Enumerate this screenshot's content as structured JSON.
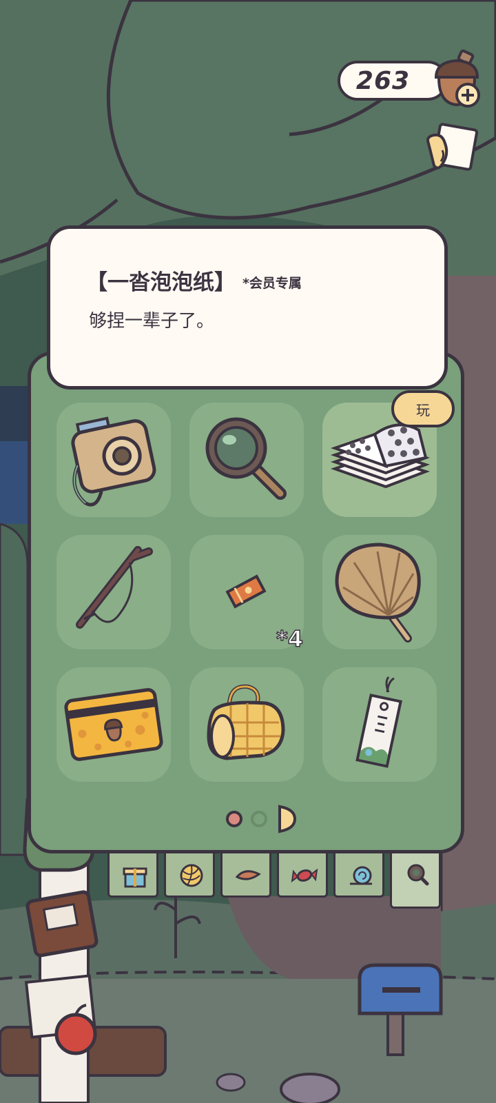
{
  "currency": {
    "amount": "263",
    "icon": "acorn-icon"
  },
  "info_card": {
    "title": "【一沓泡泡纸】",
    "tag": "*会员专属",
    "description": "够捏一辈子了。"
  },
  "play_button": {
    "label": "玩"
  },
  "inventory": {
    "items": [
      {
        "icon": "instant-camera-icon"
      },
      {
        "icon": "magnifying-glass-icon"
      },
      {
        "icon": "bubble-wrap-stack-icon",
        "selected": true
      },
      {
        "icon": "branch-slingshot-icon"
      },
      {
        "icon": "ticket-icon",
        "count": "*4"
      },
      {
        "icon": "palm-leaf-fan-icon"
      },
      {
        "icon": "acorn-card-icon"
      },
      {
        "icon": "picnic-blanket-icon"
      },
      {
        "icon": "bookmark-icon"
      }
    ]
  },
  "pagination": {
    "pages": 3,
    "current": 1
  },
  "category_tabs": [
    {
      "icon": "gift-icon"
    },
    {
      "icon": "yarn-ball-icon"
    },
    {
      "icon": "leaf-icon"
    },
    {
      "icon": "candy-icon"
    },
    {
      "icon": "snail-icon"
    },
    {
      "icon": "magnifier-icon",
      "active": true
    }
  ],
  "colors": {
    "outline": "#3b3340",
    "panel": "#7aa07c",
    "slot": "#8aae88",
    "card": "#fffaf3",
    "accent": "#f6d796",
    "dot_active": "#d98a80"
  }
}
